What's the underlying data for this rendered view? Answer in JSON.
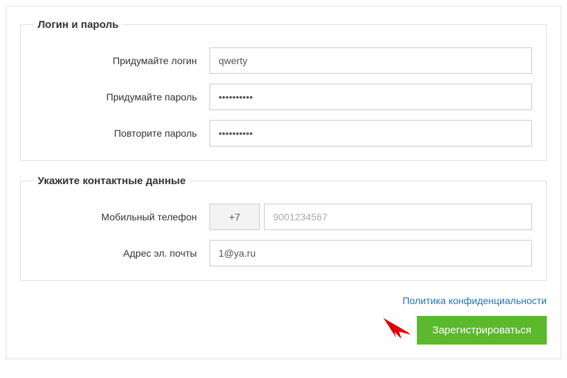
{
  "login_section": {
    "legend": "Логин и пароль",
    "login_label": "Придумайте логин",
    "login_value": "qwerty",
    "password_label": "Придумайте пароль",
    "password_value": "••••••••••",
    "password_repeat_label": "Повторите пароль",
    "password_repeat_value": "••••••••••"
  },
  "contact_section": {
    "legend": "Укажите контактные данные",
    "phone_label": "Мобильный телефон",
    "phone_prefix": "+7",
    "phone_placeholder": "9001234567",
    "phone_value": "",
    "email_label": "Адрес эл. почты",
    "email_value": "1@ya.ru"
  },
  "actions": {
    "privacy_link": "Политика конфиденциальности",
    "register_button": "Зарегистрироваться"
  }
}
